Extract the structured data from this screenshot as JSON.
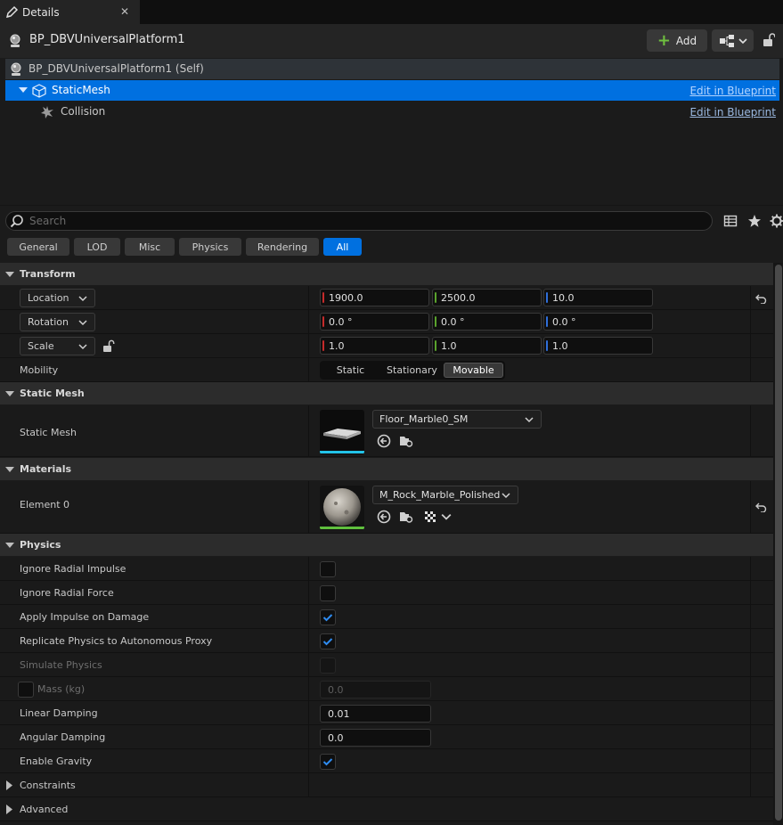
{
  "tab": {
    "label": "Details",
    "close": "✕"
  },
  "actor": {
    "name": "BP_DBVUniversalPlatform1",
    "add_label": "Add"
  },
  "tree": [
    {
      "label": "BP_DBVUniversalPlatform1 (Self)",
      "link": ""
    },
    {
      "label": "StaticMesh",
      "link": "Edit in Blueprint"
    },
    {
      "label": "Collision",
      "link": "Edit in Blueprint"
    }
  ],
  "search": {
    "placeholder": "Search",
    "value": ""
  },
  "filters": [
    "General",
    "LOD",
    "Misc",
    "Physics",
    "Rendering",
    "All"
  ],
  "active_filter": "All",
  "transform": {
    "title": "Transform",
    "location": {
      "label": "Location",
      "x": "1900.0",
      "y": "2500.0",
      "z": "10.0"
    },
    "rotation": {
      "label": "Rotation",
      "x": "0.0 °",
      "y": "0.0 °",
      "z": "0.0 °"
    },
    "scale": {
      "label": "Scale",
      "x": "1.0",
      "y": "1.0",
      "z": "1.0"
    },
    "mobility": {
      "label": "Mobility",
      "options": [
        "Static",
        "Stationary",
        "Movable"
      ],
      "selected": "Movable"
    }
  },
  "static_mesh": {
    "title": "Static Mesh",
    "label": "Static Mesh",
    "asset": "Floor_Marble0_SM"
  },
  "materials": {
    "title": "Materials",
    "label": "Element 0",
    "asset": "M_Rock_Marble_Polished"
  },
  "physics": {
    "title": "Physics",
    "ignore_radial_impulse": {
      "label": "Ignore Radial Impulse",
      "checked": false
    },
    "ignore_radial_force": {
      "label": "Ignore Radial Force",
      "checked": false
    },
    "apply_impulse_on_damage": {
      "label": "Apply Impulse on Damage",
      "checked": true
    },
    "replicate_physics": {
      "label": "Replicate Physics to Autonomous Proxy",
      "checked": true
    },
    "simulate_physics": {
      "label": "Simulate Physics",
      "checked": false
    },
    "mass": {
      "label": "Mass (kg)",
      "value": "0.0"
    },
    "linear_damping": {
      "label": "Linear Damping",
      "value": "0.01"
    },
    "angular_damping": {
      "label": "Angular Damping",
      "value": "0.0"
    },
    "enable_gravity": {
      "label": "Enable Gravity",
      "checked": true
    }
  },
  "subsections": {
    "constraints": "Constraints",
    "advanced": "Advanced"
  },
  "colors": {
    "accent": "#0070e0",
    "x_axis": "#c52b2b",
    "y_axis": "#5aa32c",
    "z_axis": "#2f6fdb",
    "add_plus": "#6fbf3f"
  }
}
